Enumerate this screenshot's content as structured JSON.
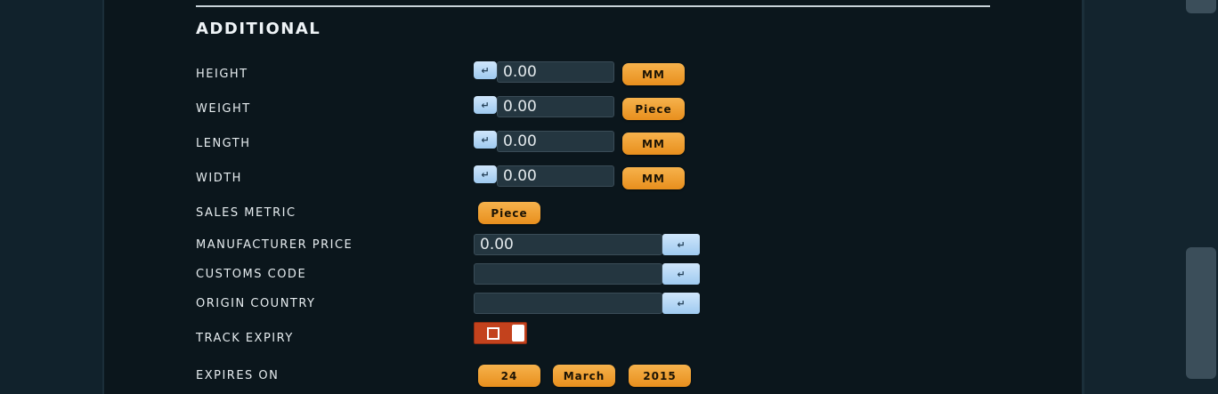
{
  "section": {
    "title": "ADDITIONAL"
  },
  "rows": {
    "height": {
      "label": "HEIGHT",
      "enter": "↵",
      "value": "0.00",
      "unit": "MM"
    },
    "weight": {
      "label": "WEIGHT",
      "enter": "↵",
      "value": "0.00",
      "unit": "Piece"
    },
    "length": {
      "label": "LENGTH",
      "enter": "↵",
      "value": "0.00",
      "unit": "MM"
    },
    "width": {
      "label": "WIDTH",
      "enter": "↵",
      "value": "0.00",
      "unit": "MM"
    },
    "sales_metric": {
      "label": "SALES METRIC",
      "value": "Piece"
    },
    "manufacturer_price": {
      "label": "MANUFACTURER PRICE",
      "value": "0.00",
      "enter": "↵"
    },
    "customs_code": {
      "label": "CUSTOMS CODE",
      "value": "",
      "enter": "↵"
    },
    "origin_country": {
      "label": "ORIGIN COUNTRY",
      "value": "",
      "enter": "↵"
    },
    "track_expiry": {
      "label": "TRACK EXPIRY",
      "state": "off"
    },
    "expires_on": {
      "label": "EXPIRES ON",
      "day": "24",
      "month": "March",
      "year": "2015"
    }
  },
  "colors": {
    "accent_orange": "#f0a03a",
    "enter_blue": "#b4d8f6",
    "toggle_red": "#c3421d",
    "panel_bg": "#0b161c"
  }
}
